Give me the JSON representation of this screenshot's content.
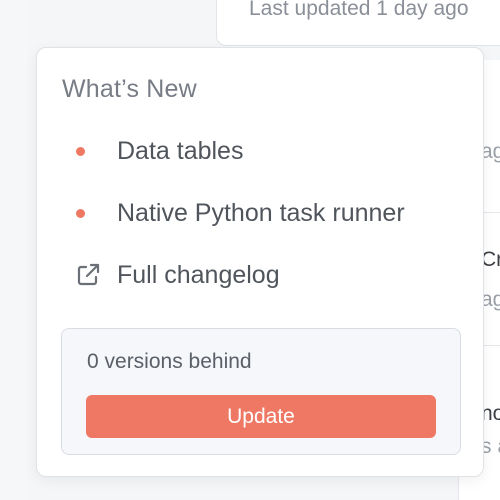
{
  "background": {
    "top_card_text": "Last updated 1 day ago",
    "right_fragments": [
      "ag",
      "Cr",
      "ag",
      "no",
      "s a"
    ]
  },
  "popover": {
    "title": "What’s New",
    "items": [
      {
        "label": "Data tables",
        "icon": "bullet-dot"
      },
      {
        "label": "Native Python task runner",
        "icon": "bullet-dot"
      }
    ],
    "changelog": {
      "label": "Full changelog",
      "icon": "external-link-icon"
    },
    "update": {
      "versions_text": "0 versions behind",
      "button_label": "Update"
    }
  },
  "colors": {
    "accent": "#ef7864",
    "bullet": "#ef7863"
  }
}
